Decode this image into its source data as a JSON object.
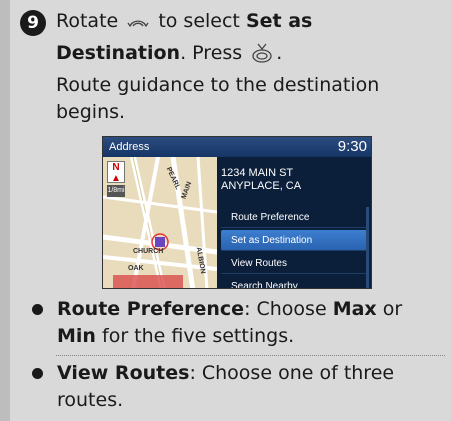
{
  "step": {
    "number": "9",
    "text_before": "Rotate",
    "text_mid": "to select",
    "bold_target": "Set as Destination",
    "text_after": ". Press",
    "text_end": ".",
    "result": "Route guidance to the destination begins."
  },
  "icons": {
    "rotate": "rotate-knob-icon",
    "press": "press-knob-icon"
  },
  "screen": {
    "title": "Address",
    "time": "9:30",
    "address_line1": "1234 MAIN ST",
    "address_line2": "ANYPLACE, CA",
    "scale_label": "1/8mi",
    "map_labels": [
      "PEARL",
      "MAIN",
      "CHURCH",
      "OAK",
      "ALBION"
    ],
    "menu": [
      {
        "label": "Route Preference"
      },
      {
        "label": "Set as Destination"
      },
      {
        "label": "View Routes"
      },
      {
        "label": "Search Nearby"
      }
    ],
    "selected_index": 1
  },
  "notes": {
    "route_pref_bold": "Route Preference",
    "route_pref_text": ": Choose",
    "max": "Max",
    "or": "or",
    "min": "Min",
    "route_pref_end": "for the five settings.",
    "view_routes_bold": "View Routes",
    "view_routes_text": ": Choose one of three routes."
  },
  "colors": {
    "panel_bg": "#d9d9d9",
    "screen_bg": "#0b1e3a",
    "selected": "#3e7ed0"
  }
}
